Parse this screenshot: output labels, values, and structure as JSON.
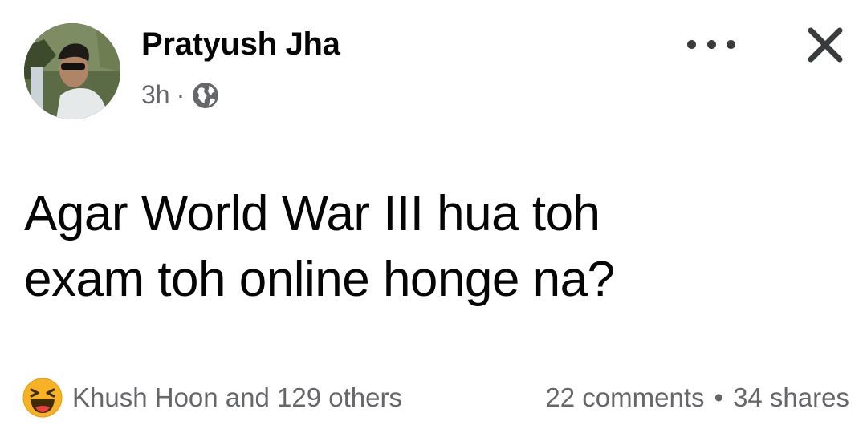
{
  "post": {
    "author": "Pratyush Jha",
    "time": "3h",
    "separator": "·",
    "audience_icon": "globe-icon",
    "text_lines": [
      "Agar World War III hua toh",
      "exam toh online honge na?"
    ]
  },
  "actions": {
    "more_icon": "more-options-icon",
    "close_icon": "close-icon"
  },
  "footer": {
    "reaction_icon": "haha-reaction-icon",
    "reactions_text": "Khush Hoon and 129 others",
    "comments_text": "22 comments",
    "dot": "•",
    "shares_text": "34 shares"
  },
  "colors": {
    "primary_text": "#050505",
    "secondary_text": "#65676b",
    "reaction_yellow": "#f7b125"
  }
}
